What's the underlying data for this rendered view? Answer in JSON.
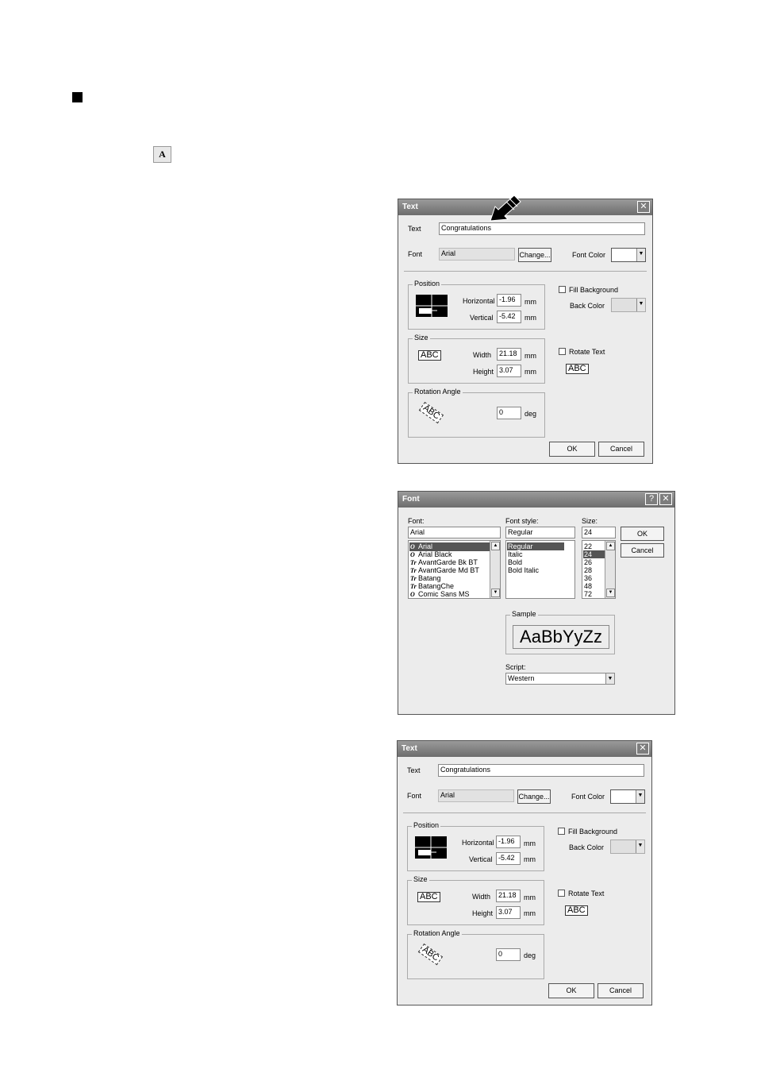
{
  "page": {
    "tool_icon_glyph": "A"
  },
  "text_dialog": {
    "title": "Text",
    "close_glyph": "✕",
    "text_label": "Text",
    "text_value": "Congratulations",
    "font_label": "Font",
    "font_value": "Arial",
    "change_button": "Change...",
    "font_color_label": "Font Color",
    "position_group": "Position",
    "horizontal_label": "Horizontal",
    "horizontal_value": "-1.96",
    "vertical_label": "Vertical",
    "vertical_value": "-5.42",
    "unit_mm": "mm",
    "size_group": "Size",
    "size_icon_text": "ABC",
    "width_label": "Width",
    "width_value": "21.18",
    "height_label": "Height",
    "height_value": "3.07",
    "rotation_group": "Rotation Angle",
    "rotation_icon_text": "ABC",
    "rotation_value": "0",
    "unit_deg": "deg",
    "fill_background_label": "Fill Background",
    "back_color_label": "Back Color",
    "rotate_text_label": "Rotate Text",
    "rotate_preview_text": "ABC",
    "ok_button": "OK",
    "cancel_button": "Cancel",
    "colors": {
      "title_bar": "#7a7a7a",
      "face": "#ececec"
    }
  },
  "font_dialog": {
    "title": "Font",
    "help_glyph": "?",
    "close_glyph": "✕",
    "font_label": "Font:",
    "font_value": "Arial",
    "font_list": [
      "Arial",
      "Arial Black",
      "AvantGarde Bk BT",
      "AvantGarde Md BT",
      "Batang",
      "BatangChe",
      "Comic Sans MS"
    ],
    "font_list_icons": [
      "O",
      "O",
      "Tr",
      "Tr",
      "Tr",
      "Tr",
      "O"
    ],
    "font_selected_index": 0,
    "style_label": "Font style:",
    "style_value": "Regular",
    "style_list": [
      "Regular",
      "Italic",
      "Bold",
      "Bold Italic"
    ],
    "style_selected_index": 0,
    "size_label": "Size:",
    "size_value": "24",
    "size_list": [
      "22",
      "24",
      "26",
      "28",
      "36",
      "48",
      "72"
    ],
    "size_selected_index": 1,
    "ok_button": "OK",
    "cancel_button": "Cancel",
    "sample_group": "Sample",
    "sample_text": "AaBbYyZz",
    "script_label": "Script:",
    "script_value": "Western"
  },
  "text_dialog_2": {
    "title": "Text",
    "close_glyph": "✕",
    "text_label": "Text",
    "text_value": "Congratulations",
    "font_label": "Font",
    "font_value": "Arial",
    "change_button": "Change...",
    "font_color_label": "Font Color",
    "position_group": "Position",
    "horizontal_label": "Horizontal",
    "horizontal_value": "-1.96",
    "vertical_label": "Vertical",
    "vertical_value": "-5.42",
    "unit_mm": "mm",
    "size_group": "Size",
    "size_icon_text": "ABC",
    "width_label": "Width",
    "width_value": "21.18",
    "height_label": "Height",
    "height_value": "3.07",
    "rotation_group": "Rotation Angle",
    "rotation_icon_text": "ABC",
    "rotation_value": "0",
    "unit_deg": "deg",
    "fill_background_label": "Fill Background",
    "back_color_label": "Back Color",
    "rotate_text_label": "Rotate Text",
    "rotate_preview_text": "ABC",
    "ok_button": "OK",
    "cancel_button": "Cancel"
  }
}
